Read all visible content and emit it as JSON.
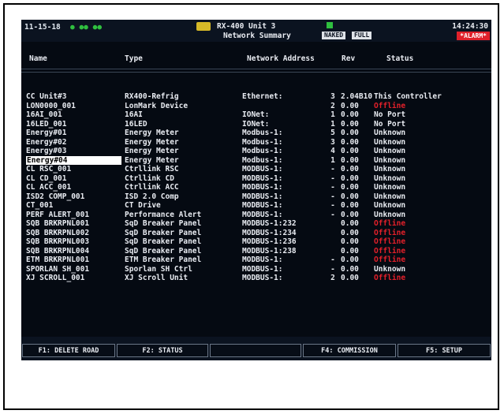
{
  "topbar": {
    "left_text": "11-15-18",
    "indicator_text": "● ●● ●●",
    "title_line1": "RX-400 Unit 3",
    "title_line2": "Network Summary",
    "badge1": "NAKED",
    "badge2": "FULL",
    "time": "14:24:30",
    "alarm": "*ALARM*"
  },
  "columns": {
    "name": "Name",
    "type": "Type",
    "network_address": "Network Address",
    "rev": "Rev",
    "status": "Status"
  },
  "rows": [
    {
      "name": "CC Unit#3",
      "type": "RX400-Refrig",
      "net": "Ethernet:",
      "addr": "3",
      "rev": "2.04B10",
      "status": "This Controller",
      "offline": false
    },
    {
      "name": "LON0000_001",
      "type": "LonMark Device",
      "net": "",
      "addr": "2",
      "rev": "0.00",
      "status": "Offline",
      "offline": true
    },
    {
      "name": "16AI_001",
      "type": "16AI",
      "net": "IONet:",
      "addr": "1",
      "rev": "0.00",
      "status": "No Port",
      "offline": false
    },
    {
      "name": "16LED_001",
      "type": "16LED",
      "net": "IONet:",
      "addr": "1",
      "rev": "0.00",
      "status": "No Port",
      "offline": false
    },
    {
      "name": "Energy#01",
      "type": "Energy Meter",
      "net": "Modbus-1:",
      "addr": "5",
      "rev": "0.00",
      "status": "Unknown",
      "offline": false
    },
    {
      "name": "Energy#02",
      "type": "Energy Meter",
      "net": "Modbus-1:",
      "addr": "3",
      "rev": "0.00",
      "status": "Unknown",
      "offline": false
    },
    {
      "name": "Energy#03",
      "type": "Energy Meter",
      "net": "Modbus-1:",
      "addr": "4",
      "rev": "0.00",
      "status": "Unknown",
      "offline": false
    },
    {
      "name": "Energy#04",
      "type": "Energy Meter",
      "net": "Modbus-1:",
      "addr": "1",
      "rev": "0.00",
      "status": "Unknown",
      "offline": false,
      "selected": true
    },
    {
      "name": "CL RSC_001",
      "type": "Ctrllink RSC",
      "net": "MODBUS-1:",
      "addr": "-",
      "rev": "0.00",
      "status": "Unknown",
      "offline": false
    },
    {
      "name": "CL CD_001",
      "type": "Ctrllink CD",
      "net": "MODBUS-1:",
      "addr": "-",
      "rev": "0.00",
      "status": "Unknown",
      "offline": false
    },
    {
      "name": "CL ACC_001",
      "type": "Ctrllink ACC",
      "net": "MODBUS-1:",
      "addr": "-",
      "rev": "0.00",
      "status": "Unknown",
      "offline": false
    },
    {
      "name": "ISD2 COMP_001",
      "type": "ISD 2.0 Comp",
      "net": "MODBUS-1:",
      "addr": "-",
      "rev": "0.00",
      "status": "Unknown",
      "offline": false
    },
    {
      "name": "CT_001",
      "type": "CT Drive",
      "net": "MODBUS-1:",
      "addr": "-",
      "rev": "0.00",
      "status": "Unknown",
      "offline": false
    },
    {
      "name": "PERF ALERT_001",
      "type": "Performance Alert",
      "net": "MODBUS-1:",
      "addr": "-",
      "rev": "0.00",
      "status": "Unknown",
      "offline": false
    },
    {
      "name": "SQB BRKRPNL001",
      "type": "SqD Breaker Panel",
      "net": "MODBUS-1:232",
      "addr": "",
      "rev": "0.00",
      "status": "Offline",
      "offline": true
    },
    {
      "name": "SQB BRKRPNL002",
      "type": "SqD Breaker Panel",
      "net": "MODBUS-1:234",
      "addr": "",
      "rev": "0.00",
      "status": "Offline",
      "offline": true
    },
    {
      "name": "SQB BRKRPNL003",
      "type": "SqD Breaker Panel",
      "net": "MODBUS-1:236",
      "addr": "",
      "rev": "0.00",
      "status": "Offline",
      "offline": true
    },
    {
      "name": "SQB BRKRPNL004",
      "type": "SqD Breaker Panel",
      "net": "MODBUS-1:238",
      "addr": "",
      "rev": "0.00",
      "status": "Offline",
      "offline": true
    },
    {
      "name": "ETM BRKRPNL001",
      "type": "ETM Breaker Panel",
      "net": "MODBUS-1:",
      "addr": "-",
      "rev": "0.00",
      "status": "Offline",
      "offline": true
    },
    {
      "name": "SPORLAN SH_001",
      "type": "Sporlan SH Ctrl",
      "net": "MODBUS-1:",
      "addr": "-",
      "rev": "0.00",
      "status": "Unknown",
      "offline": false
    },
    {
      "name": "XJ SCROLL_001",
      "type": "XJ Scroll Unit",
      "net": "MODBUS-1:",
      "addr": "2",
      "rev": "0.00",
      "status": "Offline",
      "offline": true
    }
  ],
  "function_keys": {
    "f1": "F1: DELETE ROAD",
    "f2": "F2: STATUS",
    "f3": "",
    "f4": "F4: COMMISSION",
    "f5": "F5: SETUP"
  },
  "colors": {
    "screen_bg": "#050a12",
    "text": "#e9ecf2",
    "offline": "#e3202a",
    "alarm": "#e0202a",
    "logo": "#d6b928",
    "status_led": "#2fbf3f"
  }
}
